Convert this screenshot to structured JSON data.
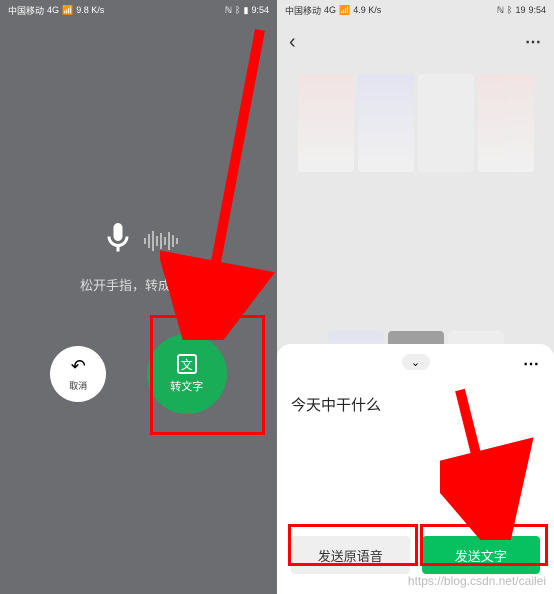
{
  "left": {
    "status": {
      "carrier": "中国移动",
      "net": "4G",
      "speed": "9.8 K/s",
      "time": "9:54"
    },
    "hint": "松开手指，转成文字",
    "cancel_label": "取消",
    "convert_icon_char": "文",
    "convert_label": "转文字"
  },
  "right": {
    "status": {
      "carrier": "中国移动",
      "net": "4G",
      "speed": "4.9 K/s",
      "battery": "19",
      "time": "9:54"
    },
    "transcription": "今天中干什么",
    "send_voice_label": "发送原语音",
    "send_text_label": "发送文字"
  },
  "watermark": "https://blog.csdn.net/cailei"
}
